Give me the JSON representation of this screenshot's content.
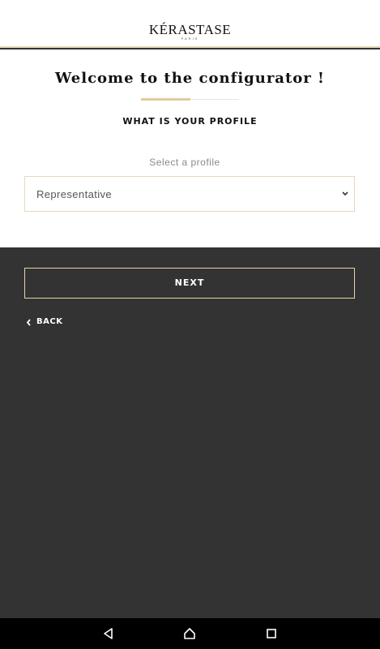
{
  "header": {
    "brand": "KÉRASTASE",
    "brand_sub": "PARIS"
  },
  "content": {
    "title": "Welcome to the configurator !",
    "subtitle": "WHAT IS YOUR PROFILE",
    "select_label": "Select a profile",
    "select_value": "Representative"
  },
  "actions": {
    "next_label": "NEXT",
    "back_label": "BACK"
  },
  "colors": {
    "accent_gold": "#e3c9a0",
    "dark_background": "#333333",
    "nav_bar": "#000000"
  },
  "icons": {
    "select": "chevron-down-icon",
    "back": "chevron-left-icon",
    "nav_back": "nav-back-triangle-icon",
    "nav_home": "nav-home-icon",
    "nav_recents": "nav-recents-square-icon"
  }
}
